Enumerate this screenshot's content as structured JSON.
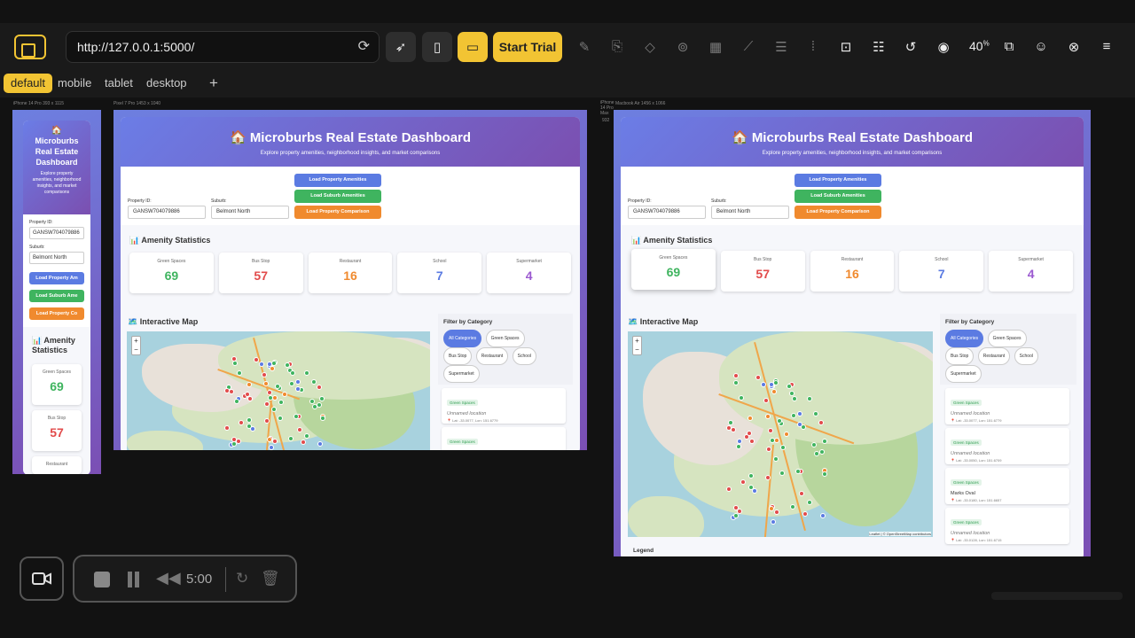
{
  "toolbar": {
    "url": "http://127.0.0.1:5000/",
    "start_trial": "Start Trial",
    "zoom": "40",
    "zoom_unit": "%"
  },
  "tabs": [
    "default",
    "mobile",
    "tablet",
    "desktop"
  ],
  "tab_add": "+",
  "devices": {
    "iphone": "iPhone 14 Pro  393 x 1115",
    "pixel": "Pixel 7 Pro  1453 x 1040",
    "macbook": "Macbook Air  1456 x 1066",
    "iphone_max": "iPhone 14 Pro Max",
    "max_size": "932"
  },
  "dashboard": {
    "title": "Microburbs Real Estate Dashboard",
    "title_mobile": "Microburbs Real Estate Dashboard",
    "house_icon": "🏠",
    "subtitle": "Explore property amenities, neighborhood insights, and market comparisons",
    "property_id_label": "Property ID:",
    "property_id": "GANSW704079886",
    "property_id_mobile": "GANSW704079886",
    "suburb_label": "Suburb:",
    "suburb": "Belmont North",
    "btn_property": "Load Property Amenities",
    "btn_suburb": "Load Suburb Amenities",
    "btn_compare": "Load Property Comparison",
    "btn_property_mobile": "Load Property Am",
    "btn_suburb_mobile": "Load Suburb Ame",
    "btn_compare_mobile": "Load Property Co",
    "stats_title": "Amenity Statistics",
    "chart_icon": "📊",
    "stats": [
      {
        "label": "Green Spaces",
        "value": "69",
        "color": "#3fb45f"
      },
      {
        "label": "Bus Stop",
        "value": "57",
        "color": "#e24b4b"
      },
      {
        "label": "Restaurant",
        "value": "16",
        "color": "#f08a2e"
      },
      {
        "label": "School",
        "value": "7",
        "color": "#5b7be2"
      },
      {
        "label": "Supermarket",
        "value": "4",
        "color": "#9b59d0"
      }
    ],
    "map_title": "Interactive Map",
    "map_icon": "🗺️",
    "filter_title": "Filter by Category",
    "filters": [
      "All Categories",
      "Green Spaces",
      "Bus Stop",
      "Restaurant",
      "School",
      "Supermarket"
    ],
    "zoom_in": "+",
    "zoom_out": "−",
    "attribution": "Leaflet | © OpenStreetMap contributors",
    "legend": "Legend",
    "places": [
      {
        "tag": "Green Spaces",
        "name": "Unnamed location",
        "coords": "📍 Lat: -33.0077, Lon: 151.6779"
      },
      {
        "tag": "Green Spaces",
        "name": "Unnamed location",
        "coords": "📍 Lat: -33.0050, Lon: 151.6709"
      },
      {
        "tag": "Green Spaces",
        "name": "Marks Oval",
        "coords": "📍 Lat: -33.0180, Lon: 151.6657"
      },
      {
        "tag": "Green Spaces",
        "name": "Unnamed location",
        "coords": "📍 Lat: -33.0128, Lon: 151.6715"
      }
    ]
  },
  "recorder": {
    "time": "5:00"
  }
}
